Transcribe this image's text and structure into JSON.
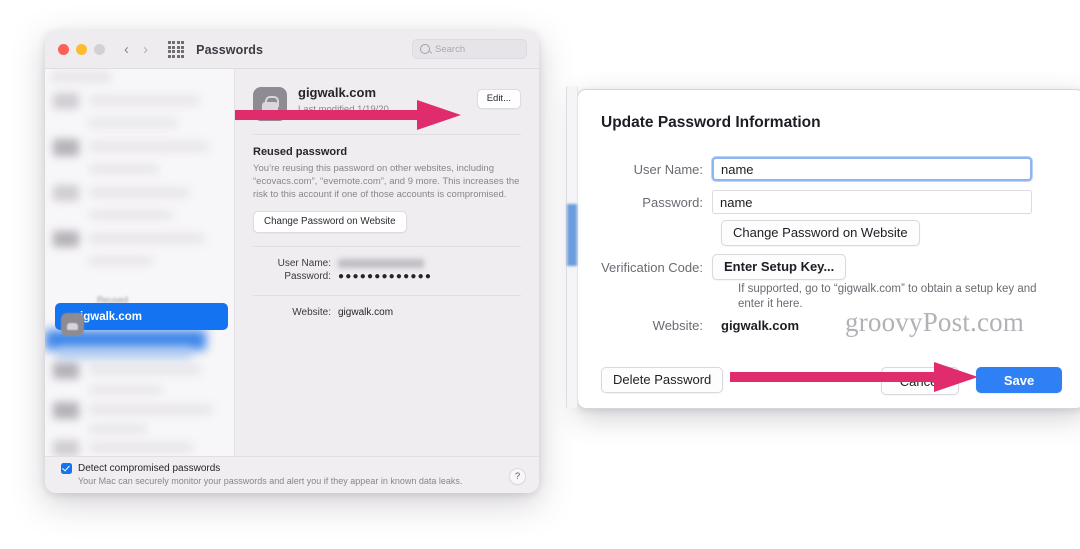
{
  "window": {
    "title": "Passwords",
    "traffic_lights": [
      "close",
      "minimize",
      "zoom"
    ],
    "nav_back_icon": "chevron-left-icon",
    "nav_forward_icon": "chevron-right-icon",
    "apps_grid_icon": "grid-icon",
    "search": {
      "placeholder": "Search",
      "value": "",
      "icon": "search-icon"
    }
  },
  "sidebar": {
    "group_label": "Reused",
    "selected_item": "gigwalk.com",
    "toolbar": {
      "add_label": "+",
      "remove_label": "−",
      "action_icon": "circle-minus-icon",
      "chevron_icon": "chevron-down-icon"
    }
  },
  "detail": {
    "site_title": "gigwalk.com",
    "last_modified": "Last modified 1/19/20",
    "edit_button": "Edit...",
    "site_icon": "password-key-icon",
    "warning": {
      "heading": "Reused password",
      "body": "You’re reusing this password on other websites, including “ecovacs.com”, “evernote.com”, and 9 more. This increases the risk to this account if one of those accounts is compromised.",
      "action_button": "Change Password on Website"
    },
    "fields": [
      {
        "label": "User Name:",
        "value": "",
        "redacted": true
      },
      {
        "label": "Password:",
        "value": "●●●●●●●●●●●●●",
        "redacted": false
      },
      {
        "label": "Website:",
        "value": "gigwalk.com",
        "redacted": false
      }
    ]
  },
  "footer": {
    "checkbox_label": "Detect compromised passwords",
    "checkbox_checked": true,
    "description": "Your Mac can securely monitor your passwords and alert you if they appear in known data leaks.",
    "help_label": "?"
  },
  "sheet": {
    "title": "Update Password Information",
    "username": {
      "label": "User Name:",
      "value": "name",
      "focused": true
    },
    "password": {
      "label": "Password:",
      "value": "name",
      "focused": false
    },
    "change_password_button": "Change Password on Website",
    "verification": {
      "label": "Verification Code:",
      "button": "Enter Setup Key...",
      "helper": "If supported, go to “gigwalk.com” to obtain a setup key and enter it here."
    },
    "website": {
      "label": "Website:",
      "value": "gigwalk.com"
    },
    "delete_button": "Delete Password",
    "cancel_button": "Cancel",
    "save_button": "Save"
  },
  "annotations": {
    "arrow_color": "#e02c6d",
    "arrow_edit_target": "Edit...",
    "arrow_save_target": "Save"
  },
  "watermark": "groovyPost.com",
  "colors": {
    "accent_blue": "#1473f0",
    "save_blue": "#2f80f5",
    "arrow_pink": "#e02c6d",
    "window_bg": "#f0eef1",
    "sidebar_bg": "#f7f6f8"
  }
}
